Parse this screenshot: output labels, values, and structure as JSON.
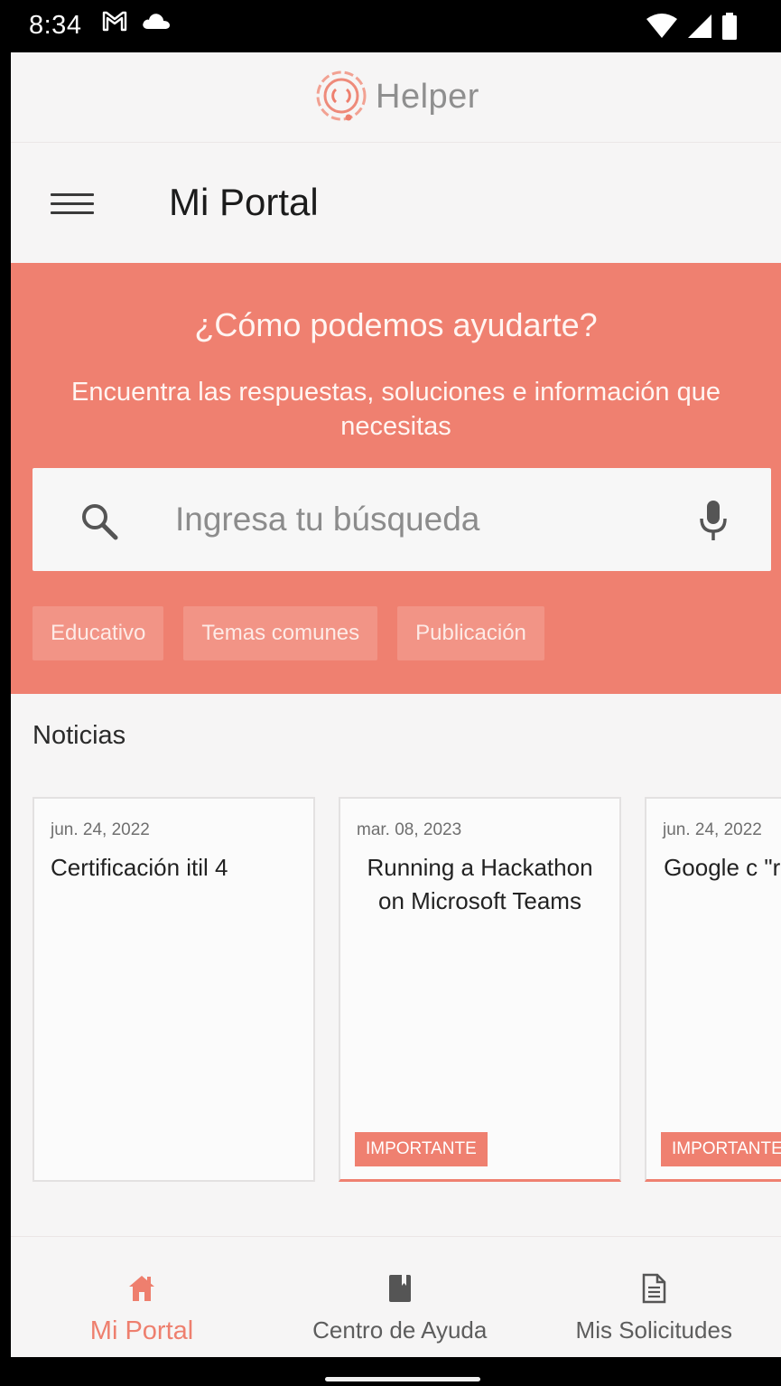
{
  "status_bar": {
    "time": "8:34",
    "icons": [
      "gmail-icon",
      "cloud-icon",
      "wifi-icon",
      "signal-icon",
      "battery-icon"
    ]
  },
  "brand": {
    "name": "Helper",
    "logo_icon": "helper-logo-icon",
    "color": "#ee7f6e"
  },
  "app_bar": {
    "menu_icon": "hamburger-menu-icon",
    "title": "Mi Portal"
  },
  "hero": {
    "background": "#ef8070",
    "title": "¿Cómo podemos ayudarte?",
    "subtitle": "Encuentra las respuestas, soluciones e información que necesitas",
    "search": {
      "placeholder": "Ingresa tu búsqueda",
      "value": "",
      "search_icon": "search-icon",
      "mic_icon": "microphone-icon"
    },
    "chips": [
      "Educativo",
      "Temas comunes",
      "Publicación"
    ]
  },
  "news": {
    "label": "Noticias",
    "cards": [
      {
        "date": "jun. 24, 2022",
        "title": "Certificación itil 4",
        "badge": ""
      },
      {
        "date": "mar. 08, 2023",
        "title": "Running a Hackathon on Microsoft Teams",
        "badge": "IMPORTANTE"
      },
      {
        "date": "jun. 24, 2022",
        "title": "Google c \"rechazar coo",
        "badge": "IMPORTANTE"
      }
    ]
  },
  "bottom_nav": {
    "items": [
      {
        "label": "Mi Portal",
        "icon": "home-icon",
        "active": true
      },
      {
        "label": "Centro de Ayuda",
        "icon": "book-icon",
        "active": false
      },
      {
        "label": "Mis Solicitudes",
        "icon": "document-icon",
        "active": false
      }
    ],
    "active_color": "#ee7f6e"
  }
}
